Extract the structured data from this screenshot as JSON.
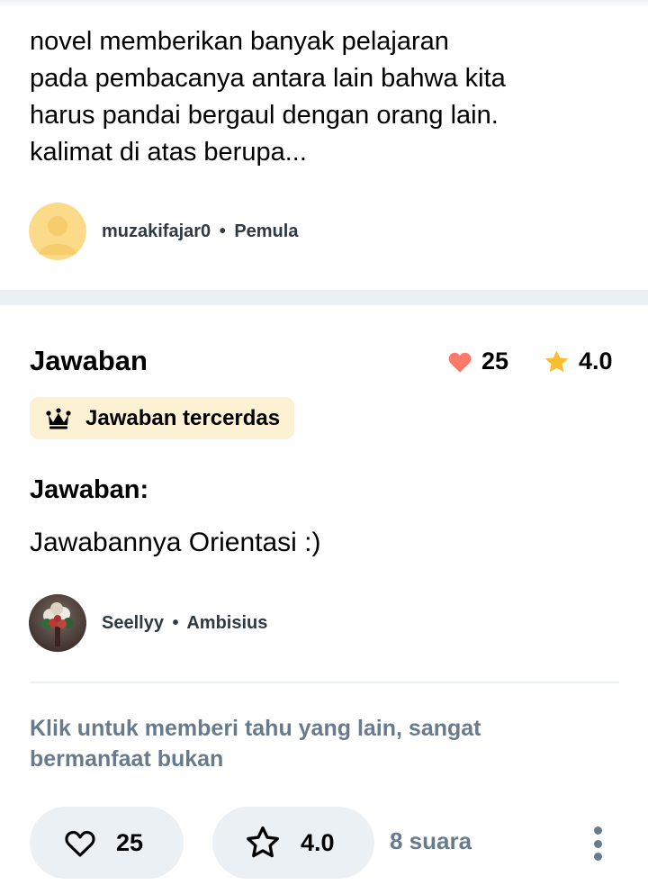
{
  "question": {
    "lines": [
      "novel memberikan banyak pelajaran",
      "pada pembacanya antara lain bahwa kita",
      "harus pandai bergaul dengan orang lain.",
      "kalimat di atas berupa..."
    ],
    "author": {
      "name": "muzakifajar0",
      "separator": "•",
      "rank": "Pemula"
    }
  },
  "answer": {
    "section_title": "Jawaban",
    "likes": "25",
    "rating": "4.0",
    "badge_label": "Jawaban tercerdas",
    "heading": "Jawaban:",
    "text": "Jawabannya Orientasi :)",
    "author": {
      "name": "Seellyy",
      "separator": "•",
      "rank": "Ambisius"
    },
    "cta": "Klik untuk memberi tahu yang lain, sangat bermanfaat bukan",
    "actions": {
      "like_count": "25",
      "rating_value": "4.0",
      "votes": "8 suara"
    }
  },
  "icons": {
    "heart": "heart-icon",
    "star": "star-icon",
    "crown": "crown-icon",
    "heart_outline": "heart-outline-icon",
    "star_outline": "star-outline-icon",
    "more": "more-vertical-icon"
  },
  "colors": {
    "heart": "#ff7968",
    "star": "#fbbe2e",
    "badge_bg": "#fdf1d3",
    "muted_text": "#687b8c",
    "band": "#ebf0f4"
  }
}
